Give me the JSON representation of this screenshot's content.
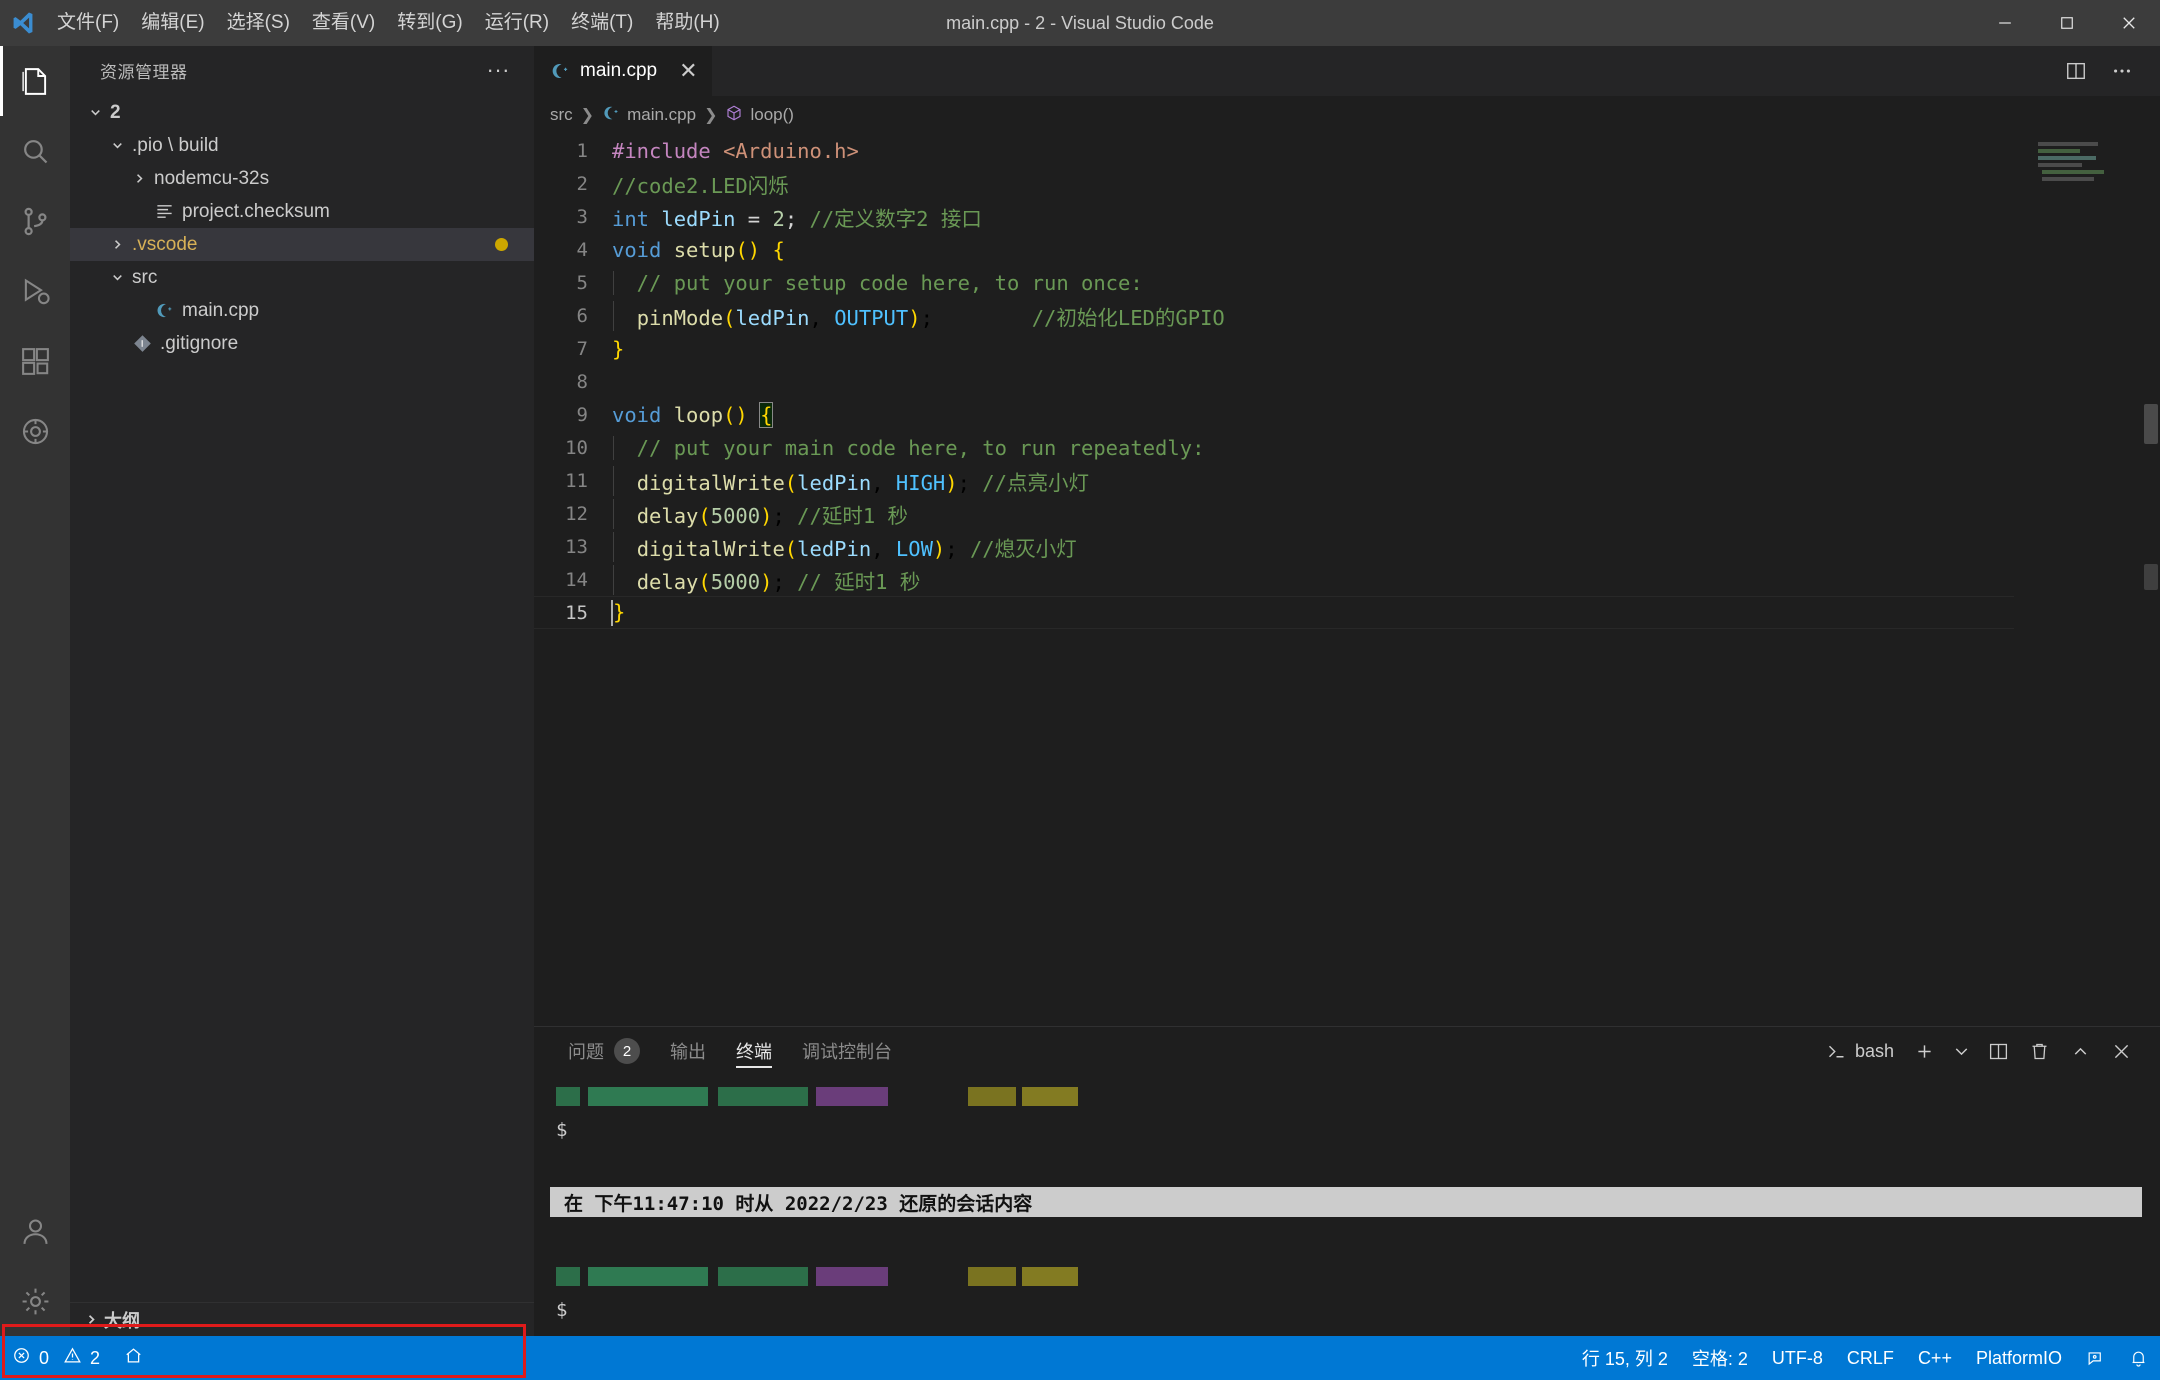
{
  "window": {
    "title": "main.cpp - 2 - Visual Studio Code",
    "logo": "vscode-logo",
    "minimize": "minimize-icon",
    "maximize": "maximize-icon",
    "close": "close-icon"
  },
  "menubar": [
    {
      "label": "文件(F)"
    },
    {
      "label": "编辑(E)"
    },
    {
      "label": "选择(S)"
    },
    {
      "label": "查看(V)"
    },
    {
      "label": "转到(G)"
    },
    {
      "label": "运行(R)"
    },
    {
      "label": "终端(T)"
    },
    {
      "label": "帮助(H)"
    }
  ],
  "activitybar": [
    {
      "name": "explorer",
      "icon": "files-icon",
      "active": true
    },
    {
      "name": "search",
      "icon": "search-icon",
      "active": false
    },
    {
      "name": "source-control",
      "icon": "source-control-icon",
      "active": false
    },
    {
      "name": "run-and-debug",
      "icon": "debug-icon",
      "active": false
    },
    {
      "name": "extensions",
      "icon": "extensions-icon",
      "active": false
    },
    {
      "name": "platformio",
      "icon": "platformio-icon",
      "active": false
    },
    {
      "name": "accounts",
      "icon": "account-icon",
      "active": false
    },
    {
      "name": "settings",
      "icon": "gear-icon",
      "active": false
    }
  ],
  "sidebar": {
    "title": "资源管理器",
    "more_actions": "···",
    "tree": [
      {
        "label": "2",
        "indent": 0,
        "twisty": "down",
        "icon": "none",
        "bold": true
      },
      {
        "label": ".pio \\ build",
        "indent": 1,
        "twisty": "down",
        "icon": "none",
        "bold": false
      },
      {
        "label": "nodemcu-32s",
        "indent": 2,
        "twisty": "right",
        "icon": "none",
        "bold": false
      },
      {
        "label": "project.checksum",
        "indent": 2,
        "twisty": "none",
        "icon": "text-file-icon",
        "bold": false
      },
      {
        "label": ".vscode",
        "indent": 1,
        "twisty": "right",
        "icon": "none",
        "bold": false,
        "selected": true,
        "amber": true,
        "dirty": true
      },
      {
        "label": "src",
        "indent": 1,
        "twisty": "down",
        "icon": "none",
        "bold": false
      },
      {
        "label": "main.cpp",
        "indent": 2,
        "twisty": "none",
        "icon": "cpp-icon",
        "bold": false
      },
      {
        "label": ".gitignore",
        "indent": 1,
        "twisty": "none",
        "icon": "git-icon",
        "bold": false
      }
    ],
    "outline_label": "大纲"
  },
  "editor": {
    "tab": {
      "label": "main.cpp",
      "icon": "cpp-icon",
      "close": "close-icon"
    },
    "tab_actions": [
      {
        "name": "split-editor",
        "icon": "split-editor-icon"
      },
      {
        "name": "more-actions",
        "icon": "ellipsis-icon"
      }
    ],
    "breadcrumbs": [
      {
        "label": "src",
        "icon": "none"
      },
      {
        "label": "main.cpp",
        "icon": "cpp-icon"
      },
      {
        "label": "loop()",
        "icon": "symbol-method-icon"
      }
    ],
    "lines": [
      {
        "n": 1,
        "text": "#include <Arduino.h>"
      },
      {
        "n": 2,
        "text": "//code2.LED闪烁"
      },
      {
        "n": 3,
        "text": "int ledPin = 2; //定义数字2 接口"
      },
      {
        "n": 4,
        "text": "void setup() {"
      },
      {
        "n": 5,
        "text": "  // put your setup code here, to run once:"
      },
      {
        "n": 6,
        "text": "  pinMode(ledPin, OUTPUT);        //初始化LED的GPIO"
      },
      {
        "n": 7,
        "text": "}"
      },
      {
        "n": 8,
        "text": ""
      },
      {
        "n": 9,
        "text": "void loop() {"
      },
      {
        "n": 10,
        "text": "  // put your main code here, to run repeatedly:"
      },
      {
        "n": 11,
        "text": "  digitalWrite(ledPin, HIGH); //点亮小灯"
      },
      {
        "n": 12,
        "text": "  delay(5000); //延时1 秒"
      },
      {
        "n": 13,
        "text": "  digitalWrite(ledPin, LOW); //熄灭小灯"
      },
      {
        "n": 14,
        "text": "  delay(5000); // 延时1 秒"
      },
      {
        "n": 15,
        "text": "}"
      }
    ]
  },
  "panel": {
    "tabs": [
      {
        "label": "问题",
        "badge": "2",
        "active": false
      },
      {
        "label": "输出",
        "badge": "",
        "active": false
      },
      {
        "label": "终端",
        "badge": "",
        "active": true
      },
      {
        "label": "调试控制台",
        "badge": "",
        "active": false
      }
    ],
    "shell_label": "bash",
    "actions": [
      {
        "name": "new-terminal",
        "icon": "plus-icon"
      },
      {
        "name": "terminal-dropdown",
        "icon": "chevron-down-icon"
      },
      {
        "name": "split-terminal",
        "icon": "split-icon"
      },
      {
        "name": "kill-terminal",
        "icon": "trash-icon"
      },
      {
        "name": "maximize-panel",
        "icon": "chevron-up-icon"
      },
      {
        "name": "close-panel",
        "icon": "close-icon"
      }
    ],
    "terminal": {
      "prompt1": "$",
      "restore_notice": "在 下午11:47:10 时从 2022/2/23 还原的会话内容",
      "prompt2": "$"
    }
  },
  "statusbar": {
    "left": [
      {
        "name": "problems",
        "icon": "error-icon",
        "label": "0",
        "icon2": "warning-icon",
        "label2": "2"
      },
      {
        "name": "platformio-home",
        "icon": "home-icon",
        "label": ""
      }
    ],
    "right": [
      {
        "name": "cursor-position",
        "label": "行 15, 列 2"
      },
      {
        "name": "indentation",
        "label": "空格: 2"
      },
      {
        "name": "encoding",
        "label": "UTF-8"
      },
      {
        "name": "eol",
        "label": "CRLF"
      },
      {
        "name": "language-mode",
        "label": "C++"
      },
      {
        "name": "platformio",
        "label": "PlatformIO"
      },
      {
        "name": "remote-feedback",
        "label": "",
        "icon": "feedback-icon"
      },
      {
        "name": "notifications",
        "label": "",
        "icon": "bell-icon"
      }
    ]
  }
}
